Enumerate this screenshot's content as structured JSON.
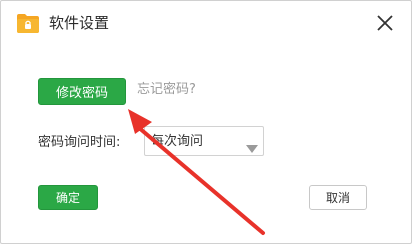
{
  "window": {
    "title": "软件设置",
    "icon": "folder-lock-icon",
    "close_icon": "close-icon"
  },
  "password": {
    "change_button_label": "修改密码",
    "forgot_link": "忘记密码?"
  },
  "interval": {
    "label": "密码询问时间:",
    "selected_value": "每次询问"
  },
  "footer": {
    "ok_label": "确定",
    "cancel_label": "取消"
  },
  "colors": {
    "accent_green": "#2ba846",
    "annotation_red": "#e8322a",
    "folder_orange": "#f5a623"
  }
}
